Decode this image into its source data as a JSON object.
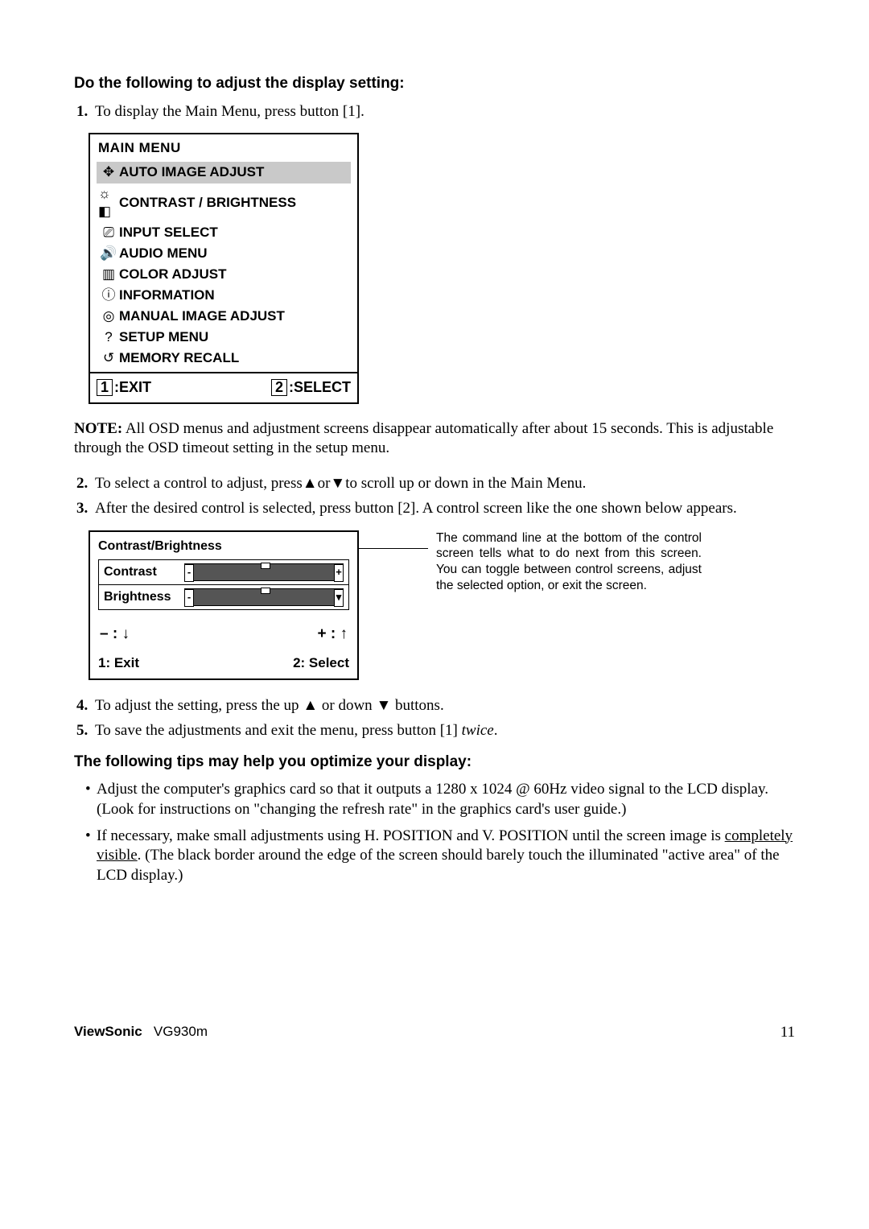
{
  "heading1": "Do the following to adjust the display setting:",
  "step1": "To display the Main Menu, press button [1].",
  "osd": {
    "title": "MAIN MENU",
    "items": [
      {
        "label": "AUTO IMAGE ADJUST",
        "icon": "✥",
        "hl": true
      },
      {
        "label": "CONTRAST / BRIGHTNESS",
        "icon": "☼ ◧",
        "hl": false
      },
      {
        "label": "INPUT SELECT",
        "icon": "⎚",
        "hl": false
      },
      {
        "label": "AUDIO MENU",
        "icon": "🔊",
        "hl": false
      },
      {
        "label": "COLOR ADJUST",
        "icon": "▥",
        "hl": false
      },
      {
        "label": "INFORMATION",
        "icon": "ⓘ",
        "hl": false
      },
      {
        "label": "MANUAL IMAGE ADJUST",
        "icon": "◎",
        "hl": false
      },
      {
        "label": "SETUP MENU",
        "icon": "?",
        "hl": false
      },
      {
        "label": "MEMORY RECALL",
        "icon": "↺",
        "hl": false
      }
    ],
    "exit_digit": "1",
    "exit_label": ":EXIT",
    "select_digit": "2",
    "select_label": ":SELECT"
  },
  "note_label": "NOTE:",
  "note_body": " All OSD menus and adjustment screens disappear automatically after about 15 seconds. This is adjustable through the OSD timeout setting in the setup menu.",
  "step2_a": "To select a control to adjust, press",
  "step2_b": "or",
  "step2_c": "to scroll up or down in the Main Menu.",
  "step3": "After the desired control is selected, press button [2]. A control screen like the one shown below appears.",
  "cb": {
    "title": "Contrast/Brightness",
    "row1": "Contrast",
    "row2": "Brightness",
    "minus_row": "– : ↓",
    "plus_row": "+ : ↑",
    "exit": "1: Exit",
    "select": "2: Select"
  },
  "callout": "The command line at the bottom of the control screen tells what to do next from this screen. You can toggle between control screens, adjust the selected option, or exit the screen.",
  "step4_a": "To adjust the setting, press the up ",
  "step4_b": " or down ",
  "step4_c": " buttons.",
  "step5_a": "To save the adjustments and exit the menu, press button [1] ",
  "step5_b": "twice",
  "step5_c": ".",
  "heading2": "The following tips may help you optimize your display:",
  "tip1": "Adjust the computer's graphics card so that it outputs a 1280 x 1024 @ 60Hz video signal to the LCD display. (Look for instructions on \"changing the refresh rate\" in the graphics card's user guide.)",
  "tip2_a": "If necessary, make small adjustments using H. POSITION and V. POSITION until the screen image is ",
  "tip2_u": "completely visible",
  "tip2_b": ". (The black border around the edge of the screen should barely touch the illuminated \"active area\" of the LCD display.)",
  "footer_brand": "ViewSonic",
  "footer_model": "VG930m",
  "page_no": "11"
}
